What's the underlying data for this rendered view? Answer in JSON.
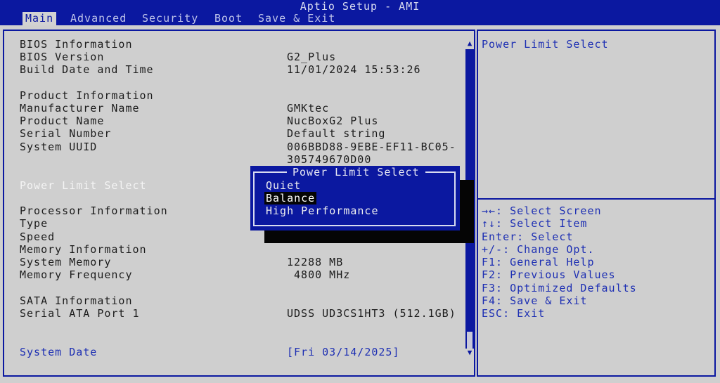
{
  "window": {
    "title": "Aptio Setup - AMI"
  },
  "tabs": [
    {
      "label": "Main"
    },
    {
      "label": "Advanced"
    },
    {
      "label": "Security"
    },
    {
      "label": "Boot"
    },
    {
      "label": "Save & Exit"
    }
  ],
  "main": {
    "bios_header": "BIOS Information",
    "bios_version_label": "BIOS Version",
    "bios_version_value": "G2_Plus",
    "build_label": "Build Date and Time",
    "build_value": "11/01/2024 15:53:26",
    "product_header": "Product Information",
    "manufacturer_label": "Manufacturer Name",
    "manufacturer_value": "GMKtec",
    "product_name_label": "Product Name",
    "product_name_value": "NucBoxG2 Plus",
    "serial_label": "Serial Number",
    "serial_value": "Default string",
    "uuid_label": "System UUID",
    "uuid_value_1": "006BBD88-9EBE-EF11-BC05-",
    "uuid_value_2": "305749670D00",
    "power_limit_label": "Power Limit Select",
    "processor_header": "Processor Information",
    "type_label": "Type",
    "speed_label": "Speed",
    "memory_header": "Memory Information",
    "system_memory_label": "System Memory",
    "system_memory_value": "12288 MB",
    "memory_freq_label": "Memory Frequency",
    "memory_freq_value": " 4800 MHz",
    "sata_header": "SATA Information",
    "sata_port_label": "Serial ATA Port 1",
    "sata_port_value": "UDSS UD3CS1HT3 (512.1GB)",
    "system_date_label": "System Date",
    "system_date_value": "[Fri 03/14/2025]"
  },
  "popup": {
    "title": "Power Limit Select",
    "options": [
      "Quiet",
      "Balance",
      "High Performance"
    ],
    "selected": "Balance"
  },
  "help": {
    "description": "Power Limit Select",
    "keys": [
      "→←: Select Screen",
      "↑↓: Select Item",
      "Enter: Select",
      "+/-: Change Opt.",
      "F1: General Help",
      "F2: Previous Values",
      "F3: Optimized Defaults",
      "F4: Save & Exit",
      "ESC: Exit"
    ]
  },
  "scroll": {
    "up_icon": "▲",
    "down_icon": "▼"
  },
  "colors": {
    "accent": "#0b18a0",
    "panel": "#cfcfcf",
    "highlight": "#050505"
  }
}
